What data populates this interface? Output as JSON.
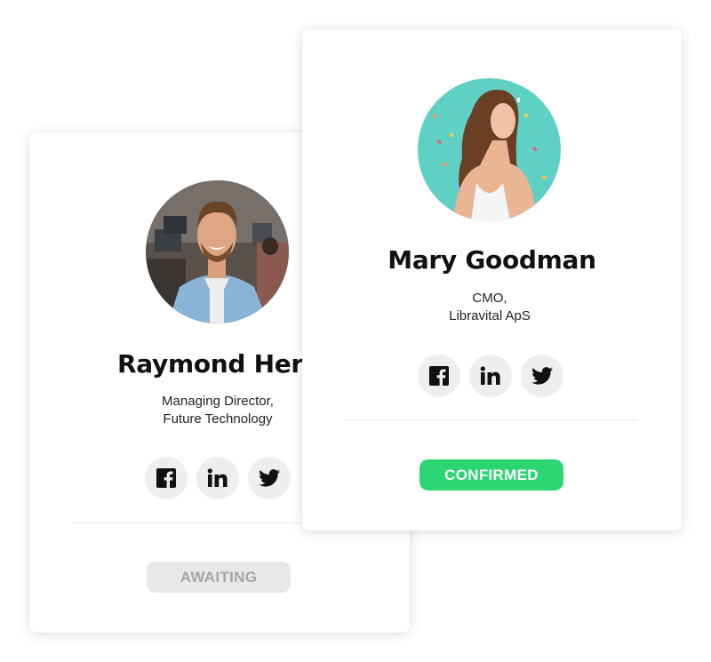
{
  "cards": [
    {
      "name": "Raymond Herrera",
      "role_line1": "Managing Director,",
      "role_line2": "Future Technology",
      "status": "AWAITING"
    },
    {
      "name": "Mary Goodman",
      "role_line1": "CMO,",
      "role_line2": "Libravital ApS",
      "status": "CONFIRMED"
    }
  ],
  "social": {
    "facebook_icon": "facebook-icon",
    "linkedin_icon": "linkedin-icon",
    "twitter_icon": "twitter-icon"
  },
  "colors": {
    "confirmed": "#2bd672",
    "awaiting_bg": "#e8e8e8",
    "awaiting_text": "#a6a6a6",
    "social_bg": "#eeeeee",
    "avatar_bg_mary": "#5fd0c4"
  }
}
